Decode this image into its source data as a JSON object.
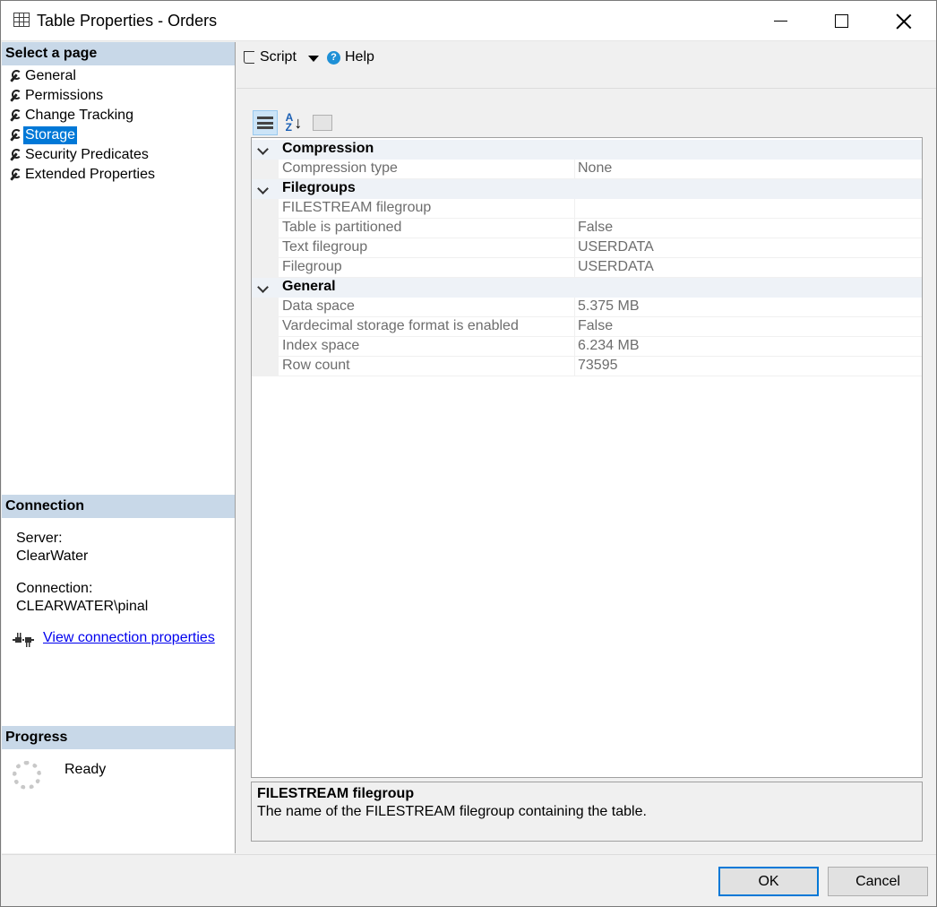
{
  "window": {
    "title": "Table Properties - Orders",
    "icon": "table-icon",
    "controls": [
      "minimize-icon",
      "maximize-icon",
      "close-icon"
    ]
  },
  "sidebar": {
    "header": "Select a page",
    "items": [
      {
        "label": "General",
        "icon": "wrench-icon",
        "selected": false
      },
      {
        "label": "Permissions",
        "icon": "wrench-icon",
        "selected": false
      },
      {
        "label": "Change Tracking",
        "icon": "wrench-icon",
        "selected": false
      },
      {
        "label": "Storage",
        "icon": "wrench-icon",
        "selected": true
      },
      {
        "label": "Security Predicates",
        "icon": "wrench-icon",
        "selected": false
      },
      {
        "label": "Extended Properties",
        "icon": "wrench-icon",
        "selected": false
      }
    ]
  },
  "connection": {
    "header": "Connection",
    "server_label": "Server:",
    "server_value": "ClearWater",
    "connection_label": "Connection:",
    "connection_value": "CLEARWATER\\pinal",
    "link_label": "View connection properties",
    "link_icon": "plug-icon"
  },
  "progress": {
    "header": "Progress",
    "status": "Ready",
    "icon": "spinner-icon"
  },
  "toolbar": {
    "script_label": "Script",
    "help_label": "Help",
    "help_icon": "question-icon"
  },
  "property_grid": {
    "toolbar_icons": [
      "categorized-icon",
      "sort-az-icon",
      "property-pages-icon"
    ],
    "categories": [
      {
        "name": "Compression",
        "rows": [
          {
            "name": "Compression type",
            "value": "None"
          }
        ]
      },
      {
        "name": "Filegroups",
        "rows": [
          {
            "name": "FILESTREAM filegroup",
            "value": ""
          },
          {
            "name": "Table is partitioned",
            "value": "False"
          },
          {
            "name": "Text filegroup",
            "value": "USERDATA"
          },
          {
            "name": "Filegroup",
            "value": "USERDATA"
          }
        ]
      },
      {
        "name": "General",
        "rows": [
          {
            "name": "Data space",
            "value": "5.375 MB"
          },
          {
            "name": "Vardecimal storage format is enabled",
            "value": "False"
          },
          {
            "name": "Index space",
            "value": "6.234 MB"
          },
          {
            "name": "Row count",
            "value": "73595"
          }
        ]
      }
    ]
  },
  "description": {
    "title": "FILESTREAM filegroup",
    "text": "The name of the FILESTREAM filegroup containing the table."
  },
  "footer": {
    "ok_label": "OK",
    "cancel_label": "Cancel"
  },
  "colors": {
    "selection": "#0078d7",
    "section_header": "#c8d8e8",
    "link": "#0000ee",
    "help_icon": "#1e90d6"
  }
}
